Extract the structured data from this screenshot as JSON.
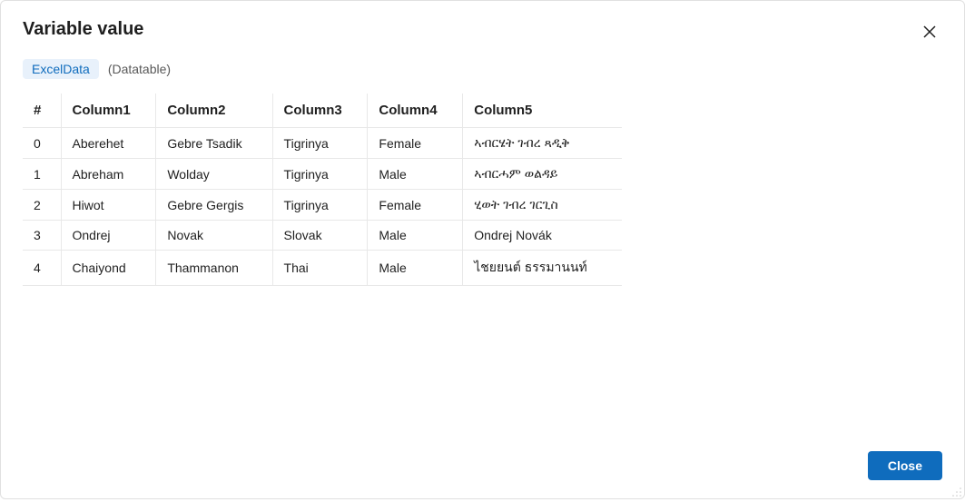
{
  "dialog": {
    "title": "Variable value",
    "close_btn_label": "Close"
  },
  "variable": {
    "name": "ExcelData",
    "type": "(Datatable)"
  },
  "table": {
    "headers": {
      "index": "#",
      "c1": "Column1",
      "c2": "Column2",
      "c3": "Column3",
      "c4": "Column4",
      "c5": "Column5"
    },
    "rows": [
      {
        "idx": "0",
        "c1": "Aberehet",
        "c2": "Gebre Tsadik",
        "c3": "Tigrinya",
        "c4": "Female",
        "c5": "ኣብርሄት ገብረ ጻዲቅ"
      },
      {
        "idx": "1",
        "c1": "Abreham",
        "c2": "Wolday",
        "c3": "Tigrinya",
        "c4": "Male",
        "c5": "ኣብርሓም ወልዳይ"
      },
      {
        "idx": "2",
        "c1": "Hiwot",
        "c2": "Gebre Gergis",
        "c3": "Tigrinya",
        "c4": "Female",
        "c5": "ሂወት ገብረ ገርጊስ"
      },
      {
        "idx": "3",
        "c1": "Ondrej",
        "c2": "Novak",
        "c3": "Slovak",
        "c4": "Male",
        "c5": "Ondrej Novák"
      },
      {
        "idx": "4",
        "c1": "Chaiyond",
        "c2": "Thammanon",
        "c3": "Thai",
        "c4": "Male",
        "c5": "ไชยยนต์ ธรรมานนท์"
      }
    ]
  }
}
